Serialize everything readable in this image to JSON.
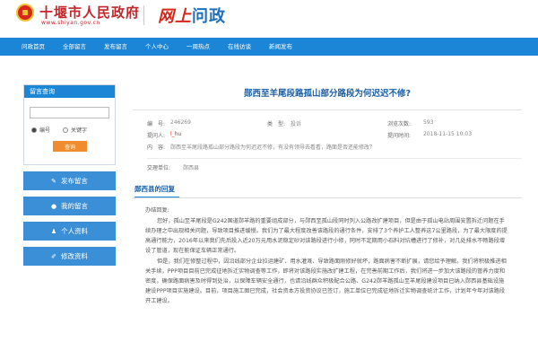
{
  "header": {
    "site_title": "十堰市人民政府",
    "site_url": "www.shiyan.gov.cn",
    "brand_part1": "网上",
    "brand_part2": "问政"
  },
  "nav": {
    "items": [
      "问政首页",
      "全部留言",
      "发布留言",
      "个人中心",
      "一周热点",
      "在线访谈",
      "新闻发布"
    ]
  },
  "sidebar": {
    "search_title": "留言查询",
    "search_placeholder": "",
    "radio_1": "编号",
    "radio_2": "关键字",
    "search_button": "查询",
    "buttons": [
      {
        "label": "发布留言",
        "icon": "pencil-icon"
      },
      {
        "label": "我的留言",
        "icon": "chat-icon"
      },
      {
        "label": "个人资料",
        "icon": "user-icon"
      },
      {
        "label": "修改资料",
        "icon": "edit-icon"
      }
    ]
  },
  "post": {
    "title": "郧西至羊尾段路孤山部分路段为何迟迟不修?",
    "id_label": "编　号:",
    "id_value": "246269",
    "type_label": "类　型:",
    "type_value": "投诉",
    "views_label": "浏览次数:",
    "views_value": "593",
    "author_label": "提问人:",
    "author_value": "l_hu",
    "time_label": "提问时间:",
    "time_value": "2018-11-15 10:03",
    "content_label": "内　容:",
    "content_value": "郧西至羊尾段路孤山部分路段为何迟迟不修，有没有领导去看看，路面是否还能修改？",
    "dept_label": "交理单位:",
    "dept_value": "郧西县"
  },
  "reply": {
    "section_title": "郧西县的回复",
    "salute": "办结回复:",
    "paragraphs": [
      "您好，孤山至羊尾段是G242国道郧羊路的重要组成部分，与郧西至孤山段同时列入公路改扩建项目，但是由于孤山电站周围安置拆迁问题在手续办理之中出现相关问题，导致项目推进缓慢。我们为了最大程度改善该路段的通行条件，安排了3个养护工人整养这7公里路段，为了最大限度的提高通行能力，2016年以来我们先后投入近20万元用水泥稳定砂对该路段进行小修，同时不定期用小石料对坑槽进行了修补，对几处排水不畅路段增设了管道，现在能保证车辆正常通行。",
      "但是，我们在修整过程中，因沿线部分企业拉运建矿、用水灌溉、导致路面刚修好就坏，路面病害不断扩展，请您给予理解。我们将积极推进相关手续，PPP项目目前已完成征地拆迁实物调查等工作，即将对该路段实施改扩建工程，在完善前期工作后，我们将进一步加大该路段的管养力度和密度，确保路面病害及时得到处治，以保障车辆安全通行，也请沿线群众积极配合公路、G242郧羊路孤山至羊尾段建设项目已纳入郧西县基础设施建设PPP项目实施建设。目前，项目施工图已完成，社会资本方投资协议已签订，施工单位已完成征地拆迁实物调查统计工作，计划年今年对该路段开工建设。"
    ]
  },
  "colors": {
    "nav_blue": "#1b86d6",
    "title_blue": "#1b5fa3",
    "site_red": "#c1272d",
    "search_orange": "#f08c2e"
  }
}
